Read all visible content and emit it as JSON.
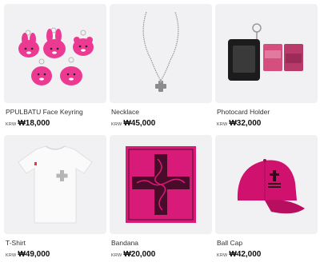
{
  "products": [
    {
      "name": "PPULBATU Face Keyring",
      "currency": "KRW",
      "price": "₩18,000",
      "image": "pink-plush-keyrings"
    },
    {
      "name": "Necklace",
      "currency": "KRW",
      "price": "₩45,000",
      "image": "silver-cross-necklace"
    },
    {
      "name": "Photocard Holder",
      "currency": "KRW",
      "price": "₩32,000",
      "image": "black-photocard-holder"
    },
    {
      "name": "T-Shirt",
      "currency": "KRW",
      "price": "₩49,000",
      "image": "white-tshirt"
    },
    {
      "name": "Bandana",
      "currency": "KRW",
      "price": "₩20,000",
      "image": "pink-cross-bandana"
    },
    {
      "name": "Ball Cap",
      "currency": "KRW",
      "price": "₩42,000",
      "image": "pink-ball-cap"
    }
  ],
  "colors": {
    "thumb_bg": "#f1f1f3",
    "hot_pink": "#e8338a",
    "magenta": "#c2185b"
  }
}
